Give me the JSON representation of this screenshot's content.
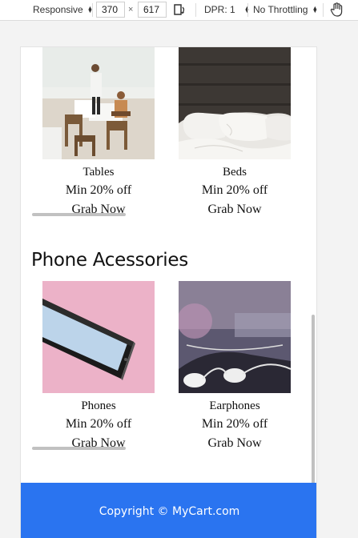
{
  "toolbar": {
    "device": "Responsive",
    "width": "370",
    "separator": "×",
    "height": "617",
    "dpr": "DPR: 1",
    "throttling": "No Throttling"
  },
  "top_section": {
    "products": [
      {
        "name": "Tables",
        "offer": "Min 20% off",
        "cta": "Grab Now"
      },
      {
        "name": "Beds",
        "offer": "Min 20% off",
        "cta": "Grab Now"
      }
    ]
  },
  "phone_section": {
    "title": "Phone Acessories",
    "products": [
      {
        "name": "Phones",
        "offer": "Min 20% off",
        "cta": "Grab Now"
      },
      {
        "name": "Earphones",
        "offer": "Min 20% off",
        "cta": "Grab Now"
      }
    ]
  },
  "footer": {
    "text": "Copyright © MyCart.com",
    "background": "#2a74f0"
  }
}
